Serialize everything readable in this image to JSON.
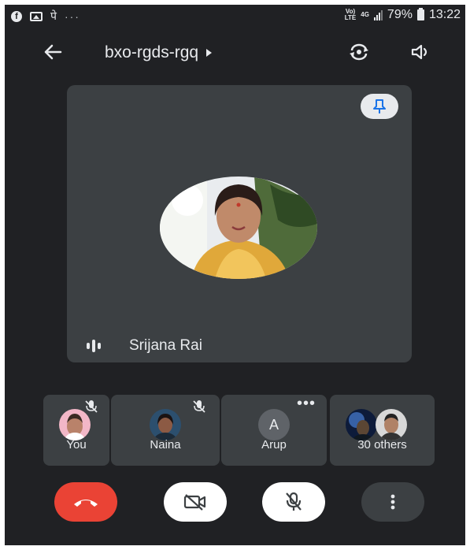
{
  "status_bar": {
    "left_icons": [
      "facebook-icon",
      "gallery-icon",
      "devanagari-app-icon",
      "more-dots-icon"
    ],
    "network_label": "4G",
    "volte_label": "Vo) LTE",
    "battery": "79%",
    "time": "13:22"
  },
  "header": {
    "meeting_code": "bxo-rgds-rgq",
    "icons": [
      "back-arrow-icon",
      "caret-right-icon",
      "switch-camera-icon",
      "speaker-icon"
    ]
  },
  "main_tile": {
    "participant_name": "Srijana Rai",
    "pinned": true
  },
  "participants": [
    {
      "label": "You",
      "muted": true
    },
    {
      "label": "Naina",
      "muted": true
    },
    {
      "label": "Arup",
      "initial": "A",
      "muted": false
    },
    {
      "label": "30 others"
    }
  ],
  "controls": [
    {
      "name": "end-call",
      "icon": "phone-hangup-icon",
      "color": "#ea4335"
    },
    {
      "name": "camera-off",
      "icon": "video-off-icon",
      "color": "#ffffff"
    },
    {
      "name": "mic-off",
      "icon": "mic-off-icon",
      "color": "#ffffff"
    },
    {
      "name": "more-options",
      "icon": "more-vert-icon",
      "color": "#3c4043"
    }
  ],
  "colors": {
    "background": "#202124",
    "tile": "#3c4043",
    "accent_blue": "#1a73e8",
    "end_call_red": "#ea4335"
  }
}
